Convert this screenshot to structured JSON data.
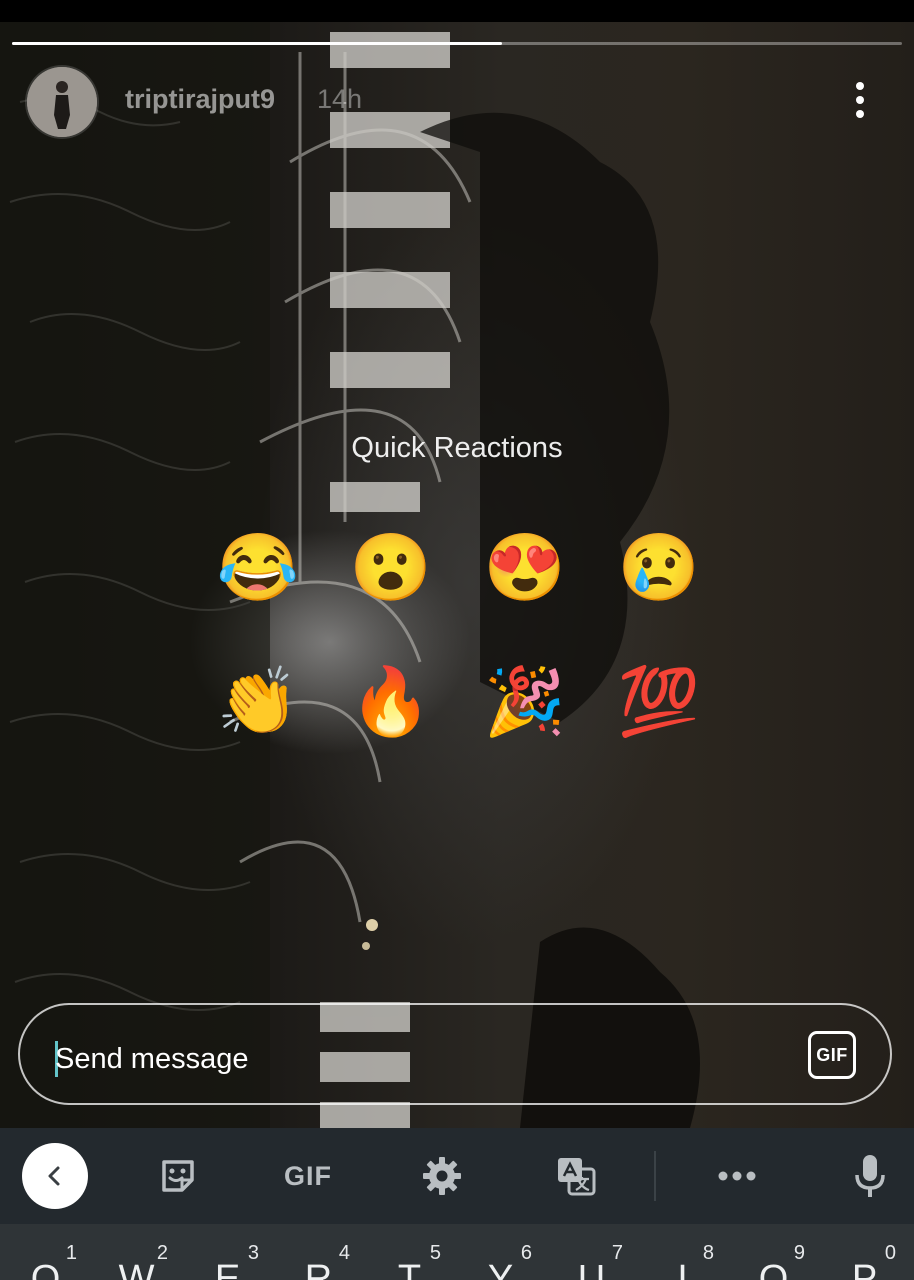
{
  "story": {
    "username": "triptirajput9",
    "time_ago": "14h",
    "progress": 0.55,
    "more_icon": "vertical-dots-icon"
  },
  "quick_reactions": {
    "title": "Quick Reactions",
    "emojis": [
      {
        "name": "face-with-tears-of-joy",
        "glyph": "😂"
      },
      {
        "name": "face-with-open-mouth",
        "glyph": "😮"
      },
      {
        "name": "smiling-face-with-heart-eyes",
        "glyph": "😍"
      },
      {
        "name": "crying-face",
        "glyph": "😢"
      },
      {
        "name": "clapping-hands",
        "glyph": "👏"
      },
      {
        "name": "fire",
        "glyph": "🔥"
      },
      {
        "name": "party-popper",
        "glyph": "🎉"
      },
      {
        "name": "hundred-points",
        "glyph": "💯"
      }
    ]
  },
  "composer": {
    "placeholder": "Send message",
    "gif_label": "GIF"
  },
  "keyboard": {
    "toolbar": {
      "back_icon": "chevron-left-icon",
      "sticker_icon": "sticker-icon",
      "gif_label": "GIF",
      "settings_icon": "gear-icon",
      "translate_icon": "translate-icon",
      "more_icon": "horizontal-dots-icon",
      "mic_icon": "microphone-icon"
    },
    "keys": [
      {
        "hint": "1",
        "letter": "Q"
      },
      {
        "hint": "2",
        "letter": "W"
      },
      {
        "hint": "3",
        "letter": "E"
      },
      {
        "hint": "4",
        "letter": "R"
      },
      {
        "hint": "5",
        "letter": "T"
      },
      {
        "hint": "6",
        "letter": "Y"
      },
      {
        "hint": "7",
        "letter": "U"
      },
      {
        "hint": "8",
        "letter": "I"
      },
      {
        "hint": "9",
        "letter": "O"
      },
      {
        "hint": "0",
        "letter": "P"
      }
    ]
  },
  "colors": {
    "keyboard_toolbar": "#23292e",
    "keyboard_keys": "#2f3437",
    "caret": "#63c4c9"
  }
}
